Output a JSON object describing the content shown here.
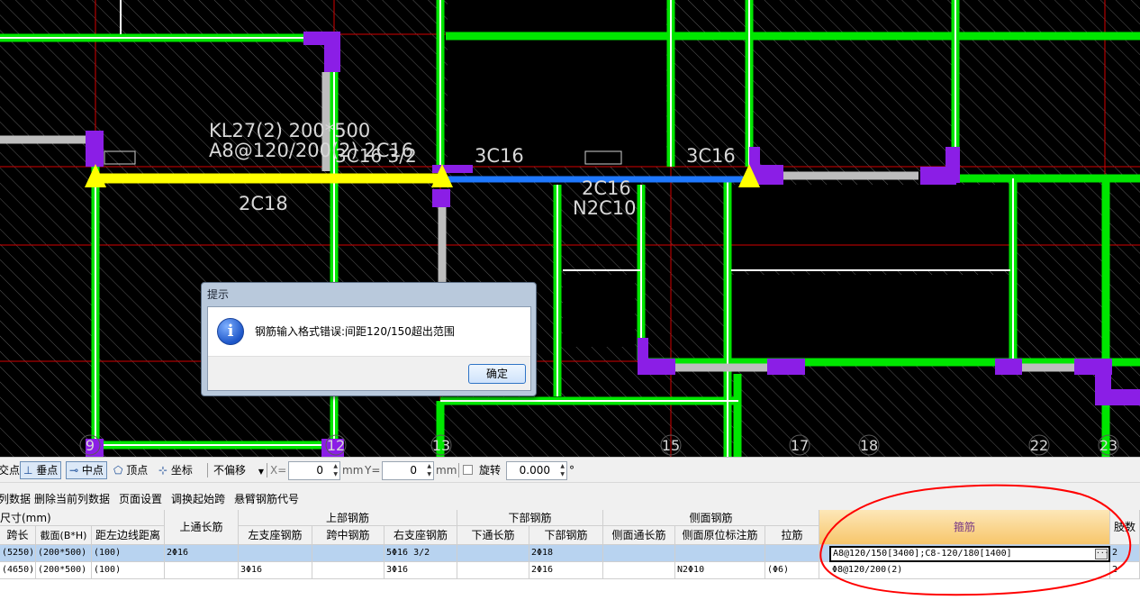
{
  "drawing": {
    "beam_label": "KL27(2) 200*500",
    "stirrup_label": "A8@120/200(2) 2C16",
    "top_mid_label": "3C16 3/2",
    "left_bottom_label": "2C18",
    "span2_top_left": "3C16",
    "span2_top_right": "3C16",
    "span2_bottom": "2C16",
    "span2_side": "N2C10",
    "axis_numbers": [
      "9",
      "12",
      "13",
      "15",
      "17",
      "18",
      "22",
      "23"
    ]
  },
  "dialog": {
    "title": "提示",
    "icon": "info-icon",
    "message": "钢筋输入格式错误:间距120/150超出范围",
    "ok_label": "确定"
  },
  "snapbar": {
    "cut_item": "交点",
    "perp": "垂点",
    "mid": "中点",
    "vertex": "顶点",
    "coord": "坐标",
    "offset_mode": "不偏移",
    "x_label": "X=",
    "x_value": "0",
    "x_unit": "mm",
    "y_label": "Y=",
    "y_value": "0",
    "y_unit": "mm",
    "rotate_label": "旋转",
    "rotate_value": "0.000",
    "rotate_unit": "°"
  },
  "menustrip": {
    "items": [
      "列数据",
      "删除当前列数据",
      "页面设置",
      "调换起始跨",
      "悬臂钢筋代号"
    ]
  },
  "table": {
    "group_headers": {
      "size": "尺寸(mm)",
      "top_through": "上通长筋",
      "top_rebar": "上部钢筋",
      "bottom_rebar": "下部钢筋",
      "side_rebar": "侧面钢筋",
      "stirrup": "箍筋",
      "legs": "肢数"
    },
    "sub_headers": {
      "span_len": "跨长",
      "section": "截面(B*H)",
      "dist": "距左边线距离",
      "left_seat": "左支座钢筋",
      "mid_span": "跨中钢筋",
      "right_seat": "右支座钢筋",
      "bottom_through": "下通长筋",
      "bottom_main": "下部钢筋",
      "side_through": "侧面通长筋",
      "side_original": "侧面原位标注筋",
      "tie": "拉筋"
    },
    "rows": [
      {
        "span_len": "(5250)",
        "section": "(200*500)",
        "dist": "(100)",
        "top_through": "2Φ16",
        "left_seat": "",
        "mid_span": "",
        "right_seat": "5Φ16 3/2",
        "bottom_through": "",
        "bottom_main": "2Φ18",
        "side_through": "",
        "side_original": "",
        "tie": "",
        "stirrup": "A8@120/150[3400];C8-120/180[1400]",
        "legs": "2"
      },
      {
        "span_len": "(4650)",
        "section": "(200*500)",
        "dist": "(100)",
        "top_through": "",
        "left_seat": "3Φ16",
        "mid_span": "",
        "right_seat": "3Φ16",
        "bottom_through": "",
        "bottom_main": "2Φ16",
        "side_through": "",
        "side_original": "N2Φ10",
        "tie": "(Φ6)",
        "stirrup": "Φ8@120/200(2)",
        "legs": "2"
      }
    ]
  },
  "colors": {
    "wall_green": "#00e600",
    "column_purple": "#8b1ee6",
    "beam_yellow": "#ffff00",
    "beam_blue": "#1e78ff",
    "annotation_red": "#ff0000",
    "selected_row": "#b8d3f0",
    "highlight_header": "#f7c66b"
  }
}
